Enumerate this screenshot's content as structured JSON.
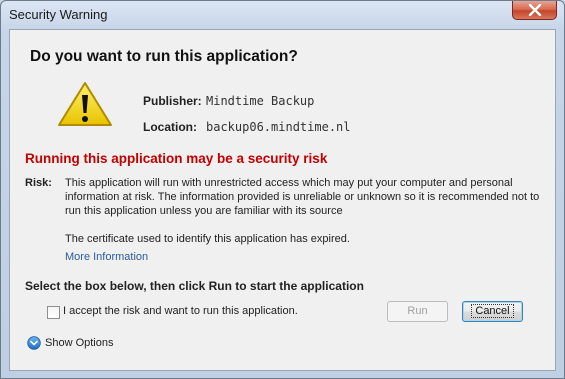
{
  "window": {
    "title": "Security Warning"
  },
  "dialog": {
    "heading": "Do you want to run this application?",
    "publisher_label": "Publisher:",
    "publisher_value": "Mindtime Backup",
    "location_label": "Location:",
    "location_value": "backup06.mindtime.nl",
    "risk_heading": "Running this application may be a security risk",
    "risk_label": "Risk:",
    "risk_text": "This application will run with unrestricted access which may put your computer and personal information at risk. The information provided is unreliable or unknown so it is recommended not to run this application unless you are familiar with its source",
    "certificate_text": "The certificate used to identify this application has expired.",
    "more_info_link": "More Information",
    "instruction": "Select the box below, then click Run to start the application",
    "accept_checkbox_label": "I accept the risk and want to run this application.",
    "accept_checked": false,
    "run_button": "Run",
    "cancel_button": "Cancel",
    "show_options": "Show Options"
  },
  "icons": {
    "warning": "warning-triangle-icon",
    "close": "close-icon",
    "options": "chevron-down-circle-icon"
  },
  "colors": {
    "risk_heading": "#c40000",
    "link": "#2a5c9a",
    "close_button": "#c4452b",
    "warning_fill": "#f5d800"
  }
}
